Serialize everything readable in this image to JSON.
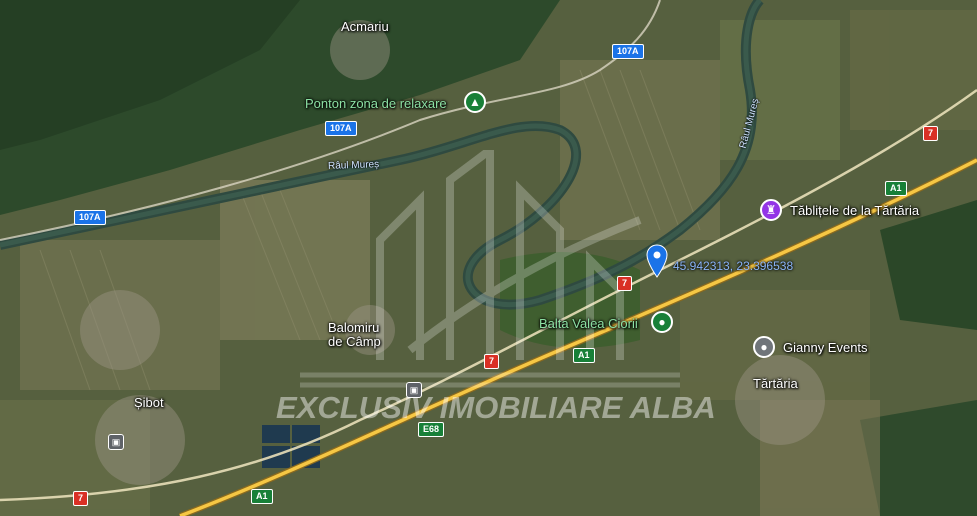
{
  "places": {
    "acmariu": "Acmariu",
    "balomiru": "Balomiru",
    "de_camp": "de Câmp",
    "sibot": "Șibot",
    "tartaria": "Tărtăria"
  },
  "pois": {
    "ponton": "Ponton zona de relaxare",
    "tablitele": "Tăblițele de la Tărtăria",
    "balta": "Balta Valea Ciorii",
    "gianny": "Gianny Events"
  },
  "rivers": {
    "mures_1": "Râul Mureș",
    "mures_2": "Râul Mureș"
  },
  "roads": {
    "r107a_1": "107A",
    "r107a_2": "107A",
    "r107a_3": "107A",
    "r7_1": "7",
    "r7_2": "7",
    "r7_3": "7",
    "r7_4": "7",
    "a1_1": "A1",
    "a1_2": "A1",
    "a1_3": "A1",
    "e68": "E68"
  },
  "pin": {
    "coordinates": "45.942313, 23.396538"
  },
  "watermark": {
    "text": "EXCLUSIV IMOBILIARE ALBA"
  },
  "colors": {
    "pin": "#1a73e8",
    "highway": "#f6c744",
    "poi_green": "#188038",
    "poi_purple": "#9334e6"
  }
}
